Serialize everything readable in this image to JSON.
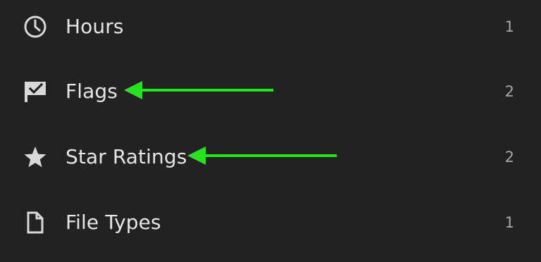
{
  "filters": {
    "items": [
      {
        "icon": "clock-icon",
        "label": "Hours",
        "count": "1"
      },
      {
        "icon": "flag-icon",
        "label": "Flags",
        "count": "2"
      },
      {
        "icon": "star-icon",
        "label": "Star Ratings",
        "count": "2"
      },
      {
        "icon": "file-icon",
        "label": "File Types",
        "count": "1"
      }
    ]
  },
  "colors": {
    "background": "#222222",
    "text": "#e6e6e6",
    "count": "#a8a8a8",
    "icon": "#d9d9d9",
    "annotation_arrow": "#22e51a"
  }
}
